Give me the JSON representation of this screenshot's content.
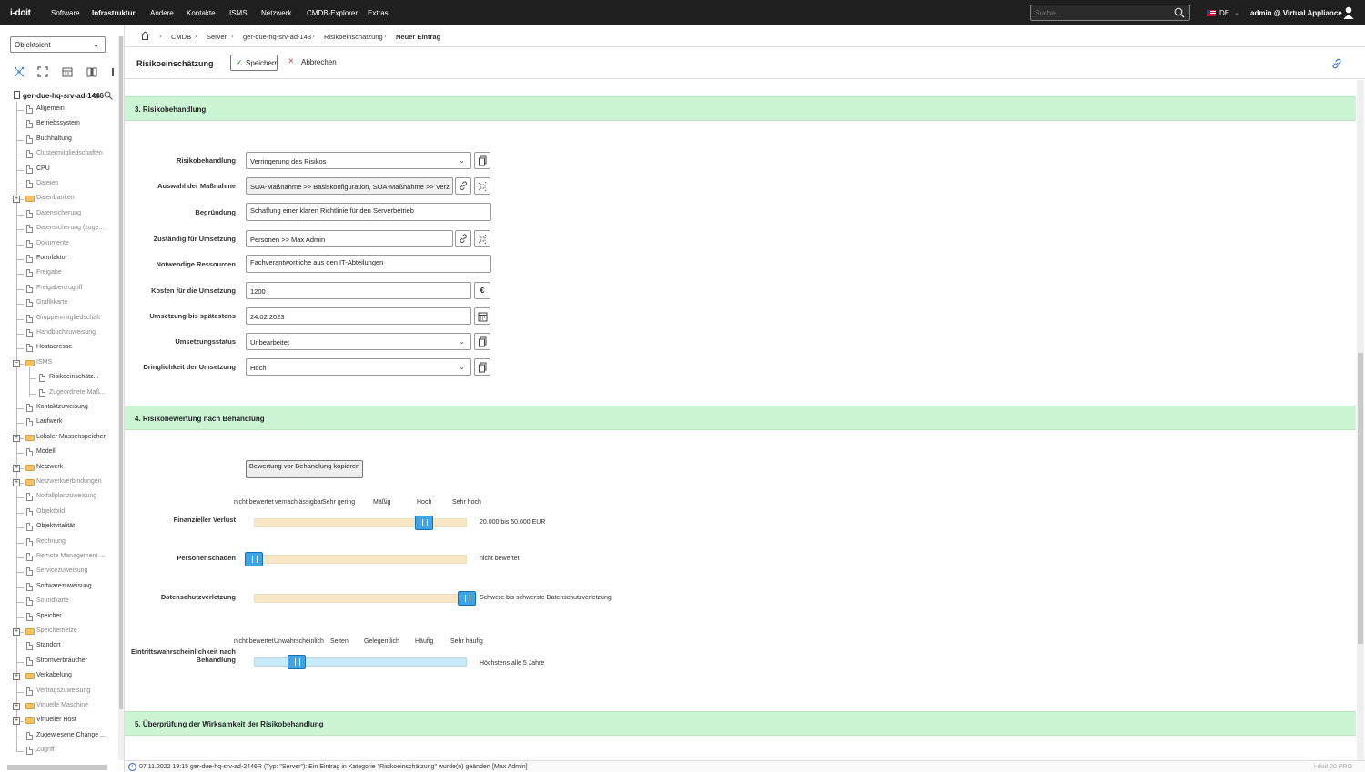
{
  "topbar": {
    "logo": "i-doit",
    "menu": [
      "Software",
      "Infrastruktur",
      "Andere",
      "Kontakte",
      "ISMS",
      "Netzwerk",
      "CMDB-Explorer",
      "Extras"
    ],
    "search_placeholder": "Suche...",
    "language": "DE",
    "user": "admin @ Virtual Appliance"
  },
  "sidebar": {
    "view_select": "Objektsicht",
    "root": "ger-due-hq-srv-ad-1446",
    "items": [
      {
        "label": "Allgemein",
        "gray": false,
        "type": "doc"
      },
      {
        "label": "Betriebssystem",
        "gray": false,
        "type": "doc"
      },
      {
        "label": "Buchhaltung",
        "gray": false,
        "type": "doc"
      },
      {
        "label": "Clustermitgliedschaften",
        "gray": true,
        "type": "doc"
      },
      {
        "label": "CPU",
        "gray": false,
        "type": "doc"
      },
      {
        "label": "Dateien",
        "gray": true,
        "type": "doc"
      },
      {
        "label": "Datenbanken",
        "gray": true,
        "type": "folder"
      },
      {
        "label": "Datensicherung",
        "gray": true,
        "type": "doc"
      },
      {
        "label": "Datensicherung (zuge...",
        "gray": true,
        "type": "doc"
      },
      {
        "label": "Dokumente",
        "gray": true,
        "type": "doc"
      },
      {
        "label": "Formfaktor",
        "gray": false,
        "type": "doc"
      },
      {
        "label": "Freigabe",
        "gray": true,
        "type": "doc"
      },
      {
        "label": "Freigabenzugriff",
        "gray": true,
        "type": "doc"
      },
      {
        "label": "Grafikkarte",
        "gray": true,
        "type": "doc"
      },
      {
        "label": "Gruppenmitgliedschaft",
        "gray": true,
        "type": "doc"
      },
      {
        "label": "Handbuchzuweisung",
        "gray": true,
        "type": "doc"
      },
      {
        "label": "Hostadresse",
        "gray": false,
        "type": "doc"
      },
      {
        "label": "ISMS",
        "gray": true,
        "type": "folder-open"
      },
      {
        "label": "Risikoeinschätz...",
        "gray": false,
        "type": "subdoc"
      },
      {
        "label": "Zugeordnete Maß...",
        "gray": true,
        "type": "subdoc"
      },
      {
        "label": "Kontaktzuweisung",
        "gray": false,
        "type": "doc"
      },
      {
        "label": "Laufwerk",
        "gray": false,
        "type": "doc"
      },
      {
        "label": "Lokaler Massenspeicher",
        "gray": false,
        "type": "folder"
      },
      {
        "label": "Modell",
        "gray": false,
        "type": "doc"
      },
      {
        "label": "Netzwerk",
        "gray": false,
        "type": "folder"
      },
      {
        "label": "Netzwerkverbindungen",
        "gray": true,
        "type": "folder"
      },
      {
        "label": "Notfallplanzuweisung",
        "gray": true,
        "type": "doc"
      },
      {
        "label": "Objektbild",
        "gray": true,
        "type": "doc"
      },
      {
        "label": "Objektvitalität",
        "gray": false,
        "type": "doc"
      },
      {
        "label": "Rechnung",
        "gray": true,
        "type": "doc"
      },
      {
        "label": "Remote Management ...",
        "gray": true,
        "type": "doc"
      },
      {
        "label": "Servicezuweisung",
        "gray": true,
        "type": "doc"
      },
      {
        "label": "Softwarezuweisung",
        "gray": false,
        "type": "doc"
      },
      {
        "label": "Soundkarte",
        "gray": true,
        "type": "doc"
      },
      {
        "label": "Speicher",
        "gray": false,
        "type": "doc"
      },
      {
        "label": "Speichernetze",
        "gray": true,
        "type": "folder"
      },
      {
        "label": "Standort",
        "gray": false,
        "type": "doc"
      },
      {
        "label": "Stromverbraucher",
        "gray": false,
        "type": "doc"
      },
      {
        "label": "Verkabelung",
        "gray": false,
        "type": "folder"
      },
      {
        "label": "Vertragszuweisung",
        "gray": true,
        "type": "doc"
      },
      {
        "label": "Virtuelle Maschine",
        "gray": true,
        "type": "folder"
      },
      {
        "label": "Virtueller Host",
        "gray": false,
        "type": "folder"
      },
      {
        "label": "Zugewiesene Change ...",
        "gray": false,
        "type": "doc"
      },
      {
        "label": "Zugriff",
        "gray": true,
        "type": "doc"
      }
    ]
  },
  "breadcrumb": [
    "CMDB",
    "Server",
    "ger-due-hq-srv-ad-143",
    "Risikoeinschätzung",
    "Neuer Eintrag"
  ],
  "header": {
    "title": "Risikoeinschätzung",
    "save": "Speichern",
    "cancel": "Abbrechen"
  },
  "section3": {
    "title": "3. Risikobehandlung",
    "fields": [
      {
        "label": "Risikobehandlung",
        "value": "Verringerung des Risikos"
      },
      {
        "label": "Auswahl der Maßnahme",
        "value": "SOA-Maßnahme >> Basiskonfiguration, SOA-Maßnahme >> Verzi"
      },
      {
        "label": "Begründung",
        "value": "Schaffung einer klaren Richtlinie für den Serverbetrieb"
      },
      {
        "label": "Zuständig für Umsetzung",
        "value": "Personen >> Max Admin"
      },
      {
        "label": "Notwendige Ressourcen",
        "value": "Fachverantwortliche aus den IT-Abteilungen"
      },
      {
        "label": "Kosten für die Umsetzung",
        "value": "1200",
        "unit": "€"
      },
      {
        "label": "Umsetzung bis spätestens",
        "value": "24.02.2023"
      },
      {
        "label": "Umsetzungsstatus",
        "value": "Unbearbeitet"
      },
      {
        "label": "Dringlichkeit der Umsetzung",
        "value": "Hoch"
      }
    ]
  },
  "section4": {
    "title": "4. Risikobewertung nach Behandlung",
    "copy_button": "Bewertung vor Behandlung kopieren",
    "impact_scale": [
      "nicht bewertet",
      "vernachlässigbar",
      "Sehr gering",
      "Mäßig",
      "Hoch",
      "Sehr hoch"
    ],
    "impact_sliders": [
      {
        "label": "Finanzieller Verlust",
        "level": 4,
        "value_text": "20.000 bis 50.000 EUR"
      },
      {
        "label": "Personenschäden",
        "level": 0,
        "value_text": "nicht bewertet"
      },
      {
        "label": "Datenschutzverletzung",
        "level": 5,
        "value_text": "Schwere bis schwerste Datenschutzverletzung"
      }
    ],
    "probability_scale": [
      "nicht bewertet",
      "Unwahrscheinlich",
      "Selten",
      "Gelegentlich",
      "Häufig",
      "Sehr häufig"
    ],
    "probability_slider": {
      "label": "Eintrittswahrscheinlichkeit nach Behandlung",
      "level": 1,
      "value_text": "Höchstens alle 5 Jahre"
    }
  },
  "section5": {
    "title": "5. Überprüfung der Wirksamkeit der Risikobehandlung"
  },
  "statusbar": {
    "message": "07.11.2022 19:15 ger-due-hq-srv-ad-2446R (Typ: \"Server\"): Ein Eintrag in Kategorie \"Risikoeinschätzung\" wurde(n) geändert [Max Admin]",
    "version": "i-doit 20 PRO"
  }
}
